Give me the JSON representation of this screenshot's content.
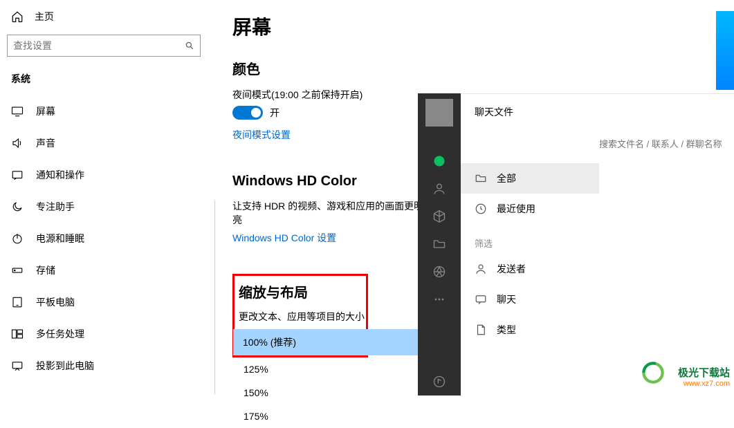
{
  "sidebar": {
    "home": "主页",
    "search_placeholder": "查找设置",
    "category": "系统",
    "items": [
      {
        "label": "屏幕"
      },
      {
        "label": "声音"
      },
      {
        "label": "通知和操作"
      },
      {
        "label": "专注助手"
      },
      {
        "label": "电源和睡眠"
      },
      {
        "label": "存储"
      },
      {
        "label": "平板电脑"
      },
      {
        "label": "多任务处理"
      },
      {
        "label": "投影到此电脑"
      }
    ]
  },
  "main": {
    "title": "屏幕",
    "color_section": "颜色",
    "night_label": "夜间模式(19:00 之前保持开启)",
    "toggle_text": "开",
    "night_link": "夜间模式设置",
    "hdcolor_title": "Windows HD Color",
    "hdcolor_desc": "让支持 HDR 的视频、游戏和应用的画面更明亮",
    "hdcolor_link": "Windows HD Color 设置",
    "scale_title": "缩放与布局",
    "scale_desc": "更改文本、应用等项目的大小",
    "scale_options": [
      "100% (推荐)",
      "125%",
      "150%",
      "175%"
    ],
    "scale_selected": 0
  },
  "chat": {
    "panel_title": "聊天文件",
    "search_placeholder": "搜索文件名 / 联系人 / 群聊名称",
    "items": [
      {
        "label": "全部"
      },
      {
        "label": "最近使用"
      }
    ],
    "filter_label": "筛选",
    "filter_items": [
      {
        "label": "发送者"
      },
      {
        "label": "聊天"
      },
      {
        "label": "类型"
      }
    ]
  },
  "branding": {
    "cn": "极光下载站",
    "url": "www.xz7.com"
  }
}
